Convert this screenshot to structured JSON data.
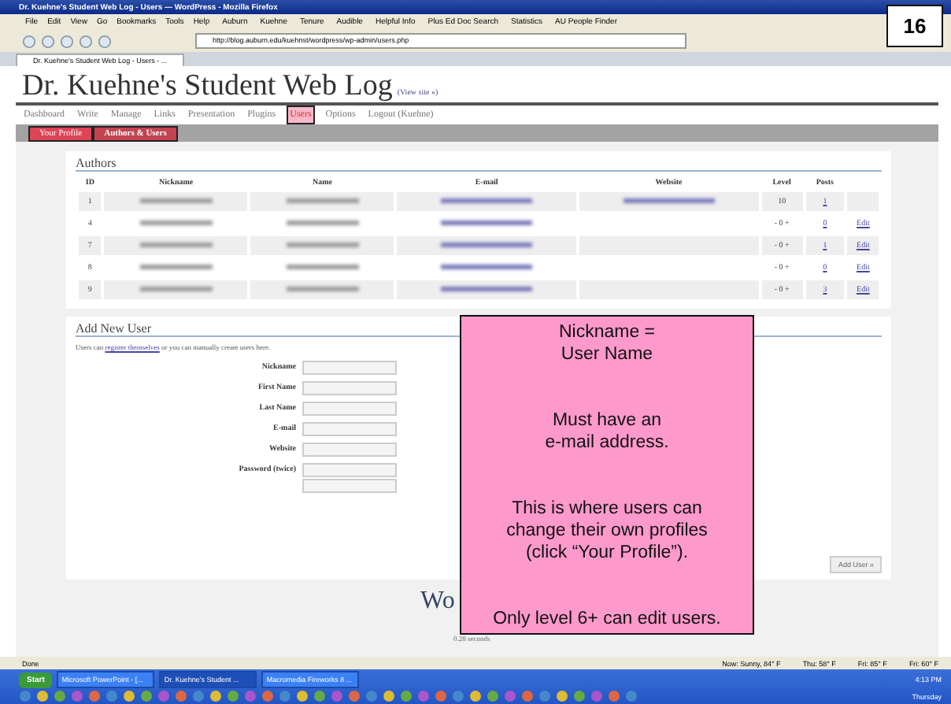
{
  "window": {
    "title": "Dr. Kuehne's Student Web Log - Users — WordPress - Mozilla Firefox"
  },
  "menu": [
    "File",
    "Edit",
    "View",
    "Go",
    "Bookmarks",
    "Tools",
    "Help"
  ],
  "bookmarks": [
    "Auburn",
    "Kuehne",
    "Tenure",
    "Audible",
    "Helpful Info",
    "Plus Ed Doc Search",
    "Statistics",
    "AU People Finder"
  ],
  "address": "http://blog.auburn.edu/kuehnst/wordpress/wp-admin/users.php",
  "browser_tab": "Dr. Kuehne's Student Web Log - Users - ...",
  "blog": {
    "title": "Dr. Kuehne's Student Web Log",
    "view_site": "(View site »)"
  },
  "nav": [
    {
      "label": "Dashboard",
      "selected": false
    },
    {
      "label": "Write",
      "selected": false
    },
    {
      "label": "Manage",
      "selected": false
    },
    {
      "label": "Links",
      "selected": false
    },
    {
      "label": "Presentation",
      "selected": false
    },
    {
      "label": "Plugins",
      "selected": false
    },
    {
      "label": "Users",
      "selected": true
    },
    {
      "label": "Options",
      "selected": false
    },
    {
      "label": "Logout (Kuehne)",
      "selected": false
    }
  ],
  "subtabs": [
    {
      "label": "Your Profile",
      "selected": false
    },
    {
      "label": "Authors & Users",
      "selected": true
    }
  ],
  "authors": {
    "title": "Authors",
    "columns": [
      "ID",
      "Nickname",
      "Name",
      "E-mail",
      "Website",
      "Level",
      "Posts"
    ],
    "rows": [
      {
        "id": "1",
        "level": "10",
        "posts": "1",
        "edit": ""
      },
      {
        "id": "4",
        "level": "- 0 +",
        "posts": "0",
        "edit": "Edit"
      },
      {
        "id": "7",
        "level": "- 0 +",
        "posts": "1",
        "edit": "Edit"
      },
      {
        "id": "8",
        "level": "- 0 +",
        "posts": "0",
        "edit": "Edit"
      },
      {
        "id": "9",
        "level": "- 0 +",
        "posts": "3",
        "edit": "Edit"
      }
    ]
  },
  "add_user": {
    "title": "Add New User",
    "link": "register themselves",
    "before": "Users can ",
    "after": " or you can manually create users here.",
    "fields": [
      {
        "label": "Nickname",
        "kind": "single"
      },
      {
        "label": "First Name",
        "kind": "single"
      },
      {
        "label": "Last Name",
        "kind": "single"
      },
      {
        "label": "E-mail",
        "kind": "single"
      },
      {
        "label": "Website",
        "kind": "single"
      },
      {
        "label": "Password (twice)",
        "kind": "double"
      }
    ],
    "button": "Add User »"
  },
  "footer": {
    "logo": "Wo",
    "time": "0.28 seconds"
  },
  "status_bar": {
    "text": "Done",
    "weather": [
      "Now: Sunny, 84° F",
      "Thu: 58° F",
      "Fri: 85° F",
      "Fri: 60° F"
    ]
  },
  "taskbar": {
    "start": "Start",
    "items": [
      {
        "label": "Microsoft PowerPoint - [...",
        "selected": false
      },
      {
        "label": "Dr. Kuehne's Student ...",
        "selected": true
      },
      {
        "label": "Macromedia Fireworks 8 ...",
        "selected": false
      }
    ],
    "time": "4:13 PM",
    "day": "Thursday"
  },
  "callout": [
    "Nickname =\nUser Name",
    "Must have an\ne-mail address.",
    "This is where users can\nchange their own profiles\n(click “Your Profile”).",
    "Only level 6+ can edit users."
  ],
  "slide_number": "16"
}
